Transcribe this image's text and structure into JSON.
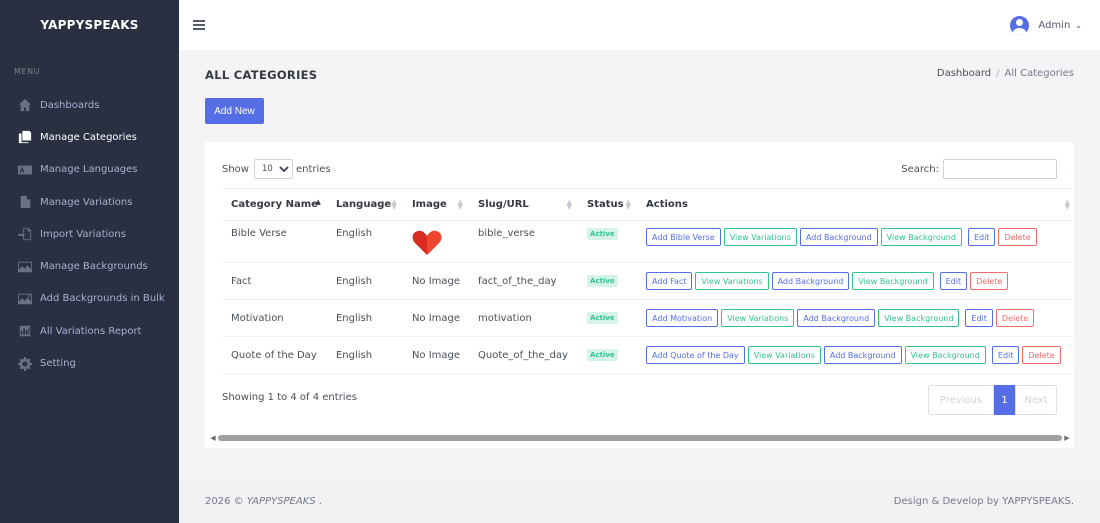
{
  "sidebar": {
    "brand": "YAPPYSPEAKS",
    "menu_title": "MENU",
    "items": [
      {
        "label": "Dashboards",
        "icon": "home-icon"
      },
      {
        "label": "Manage Categories",
        "icon": "copy-icon"
      },
      {
        "label": "Manage Languages",
        "icon": "language-icon"
      },
      {
        "label": "Manage Variations",
        "icon": "file-icon"
      },
      {
        "label": "Import Variations",
        "icon": "import-icon"
      },
      {
        "label": "Manage Backgrounds",
        "icon": "image-icon"
      },
      {
        "label": "Add Backgrounds in Bulk",
        "icon": "image-add-icon"
      },
      {
        "label": "All Variations Report",
        "icon": "report-icon"
      },
      {
        "label": "Setting",
        "icon": "gear-icon"
      }
    ]
  },
  "topbar": {
    "user_name": "Admin"
  },
  "page": {
    "title": "ALL CATEGORIES",
    "breadcrumb": {
      "home": "Dashboard",
      "sep": "/",
      "current": "All Categories"
    },
    "add_new_label": "Add New"
  },
  "table_controls": {
    "show_label": "Show",
    "entries_value": "10",
    "entries_label": "entries",
    "search_label": "Search:"
  },
  "table": {
    "headers": [
      "Category Name",
      "Language",
      "Image",
      "Slug/URL",
      "Status",
      "Actions"
    ],
    "rows": [
      {
        "name": "Bible Verse",
        "language": "English",
        "image": "",
        "slug": "bible_verse",
        "status": "Active",
        "add_label": "Add Bible Verse"
      },
      {
        "name": "Fact",
        "language": "English",
        "image": "No Image",
        "slug": "fact_of_the_day",
        "status": "Active",
        "add_label": "Add Fact"
      },
      {
        "name": "Motivation",
        "language": "English",
        "image": "No Image",
        "slug": "motivation",
        "status": "Active",
        "add_label": "Add Motivation"
      },
      {
        "name": "Quote of the Day",
        "language": "English",
        "image": "No Image",
        "slug": "Quote_of_the_day",
        "status": "Active",
        "add_label": "Add Quote of the Day"
      }
    ],
    "action_labels": {
      "view_variations": "View Variations",
      "add_background": "Add Background",
      "view_background": "View Background",
      "edit": "Edit",
      "delete": "Delete"
    }
  },
  "info_text": "Showing 1 to 4 of 4 entries",
  "pagination": {
    "previous": "Previous",
    "current_page": "1",
    "next": "Next"
  },
  "footer": {
    "left_prefix": "2026 © ",
    "left_brand": "YAPPYSPEAKS",
    "left_suffix": " .",
    "right": "Design & Develop by YAPPYSPEAKS."
  },
  "colors": {
    "sidebar_bg": "#2a3042",
    "primary": "#556ee6",
    "success": "#34c38f",
    "danger": "#f46a6a"
  }
}
